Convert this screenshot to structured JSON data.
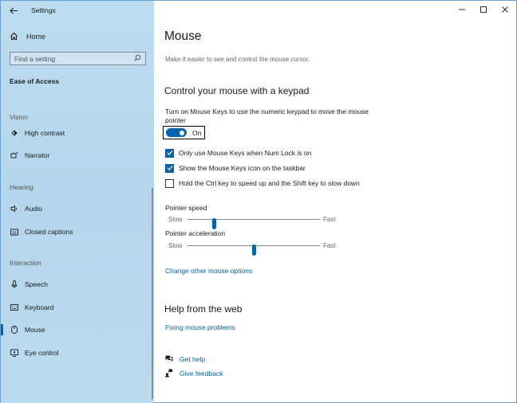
{
  "titlebar": {
    "app_title": "Settings"
  },
  "sidebar": {
    "home_label": "Home",
    "search_placeholder": "Find a setting",
    "section_title": "Ease of Access",
    "groups": {
      "vision": "Vision",
      "hearing": "Hearing",
      "interaction": "Interaction"
    },
    "items": {
      "high_contrast": "High contrast",
      "narrator": "Narrator",
      "audio": "Audio",
      "closed_captions": "Closed captions",
      "speech": "Speech",
      "keyboard": "Keyboard",
      "mouse": "Mouse",
      "eye_control": "Eye control"
    },
    "selected": "mouse"
  },
  "main": {
    "title": "Mouse",
    "description": "Make it easier to see and control the mouse cursor.",
    "keypad_heading": "Control your mouse with a keypad",
    "mouse_keys_desc": "Turn on Mouse Keys to use the numeric keypad to move the mouse pointer",
    "toggle_state": "On",
    "checkboxes": {
      "num_lock": {
        "label": "Only use Mouse Keys when Num Lock is on",
        "checked": true
      },
      "taskbar_icon": {
        "label": "Show the Mouse Keys icon on the taskbar",
        "checked": true
      },
      "ctrl_shift": {
        "label": "Hold the Ctrl key to speed up and the Shift key to slow down",
        "checked": false
      }
    },
    "pointer_speed": {
      "label": "Pointer speed",
      "min_label": "Slow",
      "max_label": "Fast",
      "level": 0.2
    },
    "pointer_acceleration": {
      "label": "Pointer acceleration",
      "min_label": "Slow",
      "max_label": "Fast",
      "level": 0.5
    },
    "other_options_link": "Change other mouse options",
    "help_heading": "Help from the web",
    "help_link": "Fixing mouse problems",
    "get_help": "Get help",
    "give_feedback": "Give feedback"
  },
  "colors": {
    "accent": "#0063b1",
    "sidebar_bg": "#b8d8ed"
  }
}
